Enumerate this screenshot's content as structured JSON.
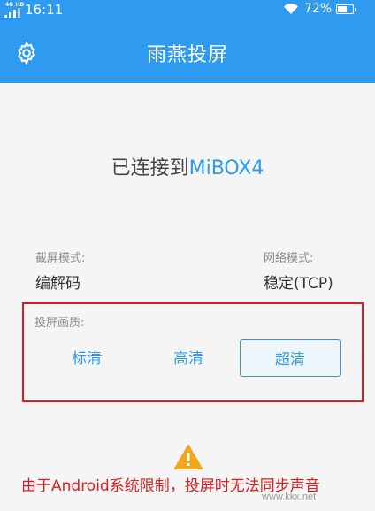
{
  "status_bar": {
    "network": "4G HD",
    "time": "16:11",
    "battery_percent": "72%",
    "battery_level": 0.72
  },
  "header": {
    "title": "雨燕投屏",
    "settings_icon": "gear-icon"
  },
  "connection": {
    "prefix": "已连接到",
    "device": "MiBOX4"
  },
  "capture_mode": {
    "label": "截屏模式:",
    "value": "编解码"
  },
  "network_mode": {
    "label": "网络模式:",
    "value": "稳定(TCP)"
  },
  "quality": {
    "label": "投屏画质:",
    "options": [
      "标清",
      "高清",
      "超清"
    ],
    "selected": "超清"
  },
  "notice": {
    "icon": "warning-icon",
    "text": "由于Android系统限制，投屏时无法同步声音"
  },
  "watermark": "www.kkx.net",
  "colors": {
    "primary": "#2f9bf0",
    "highlight_border": "#d9201f",
    "notice_text": "#d9201f"
  }
}
